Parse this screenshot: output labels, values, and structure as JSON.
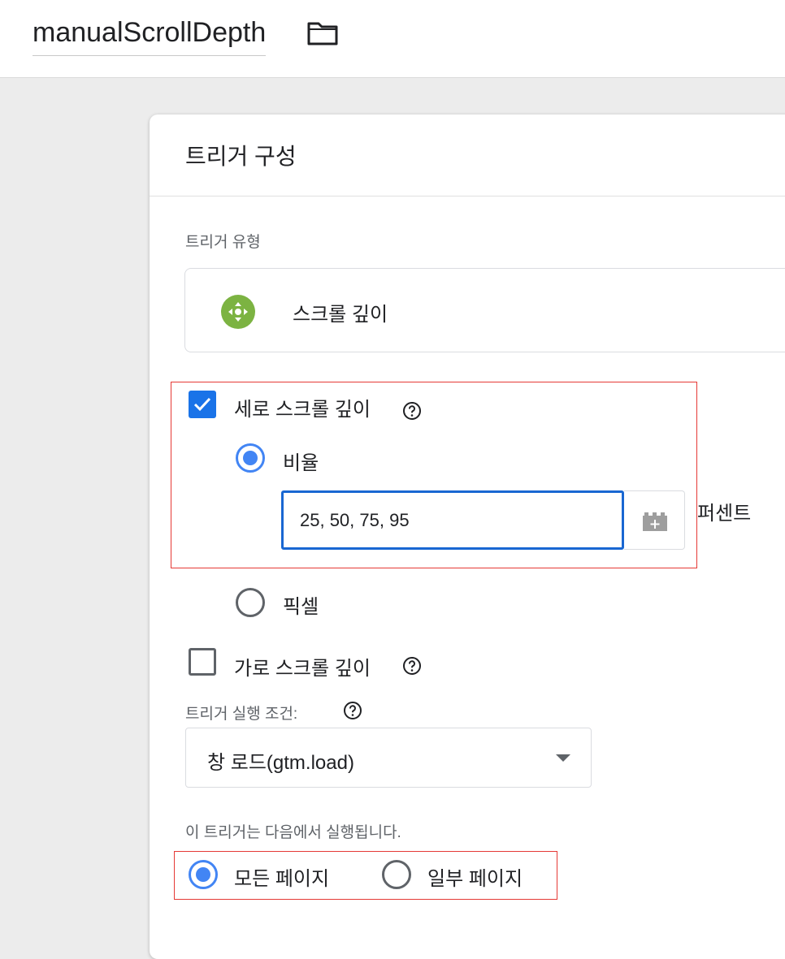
{
  "header": {
    "tag_name": "manualScrollDepth",
    "folder_icon": "folder-icon"
  },
  "card": {
    "title": "트리거 구성",
    "trigger_type_label": "트리거 유형",
    "trigger_type": {
      "name": "스크롤 깊이",
      "icon": "scroll-depth-icon",
      "icon_color": "#7cb342"
    },
    "vertical": {
      "checked": true,
      "label": "세로 스크롤 깊이",
      "percent_option": {
        "label": "비율",
        "selected": true
      },
      "percent_input": {
        "value": "25, 50, 75, 95",
        "unit": "퍼센트"
      },
      "pixel_option": {
        "label": "픽셀",
        "selected": false
      }
    },
    "horizontal": {
      "checked": false,
      "label": "가로 스크롤 깊이"
    },
    "fire_on_label": "트리거 실행 조건:",
    "fire_on_value": "창 로드(gtm.load)",
    "fires_on_label": "이 트리거는 다음에서 실행됩니다.",
    "fires_on_options": [
      {
        "label": "모든 페이지",
        "selected": true
      },
      {
        "label": "일부 페이지",
        "selected": false
      }
    ]
  },
  "colors": {
    "accent": "#1a73e8",
    "radio": "#4285f4",
    "highlight": "#e53935",
    "icon_green": "#7cb342"
  }
}
